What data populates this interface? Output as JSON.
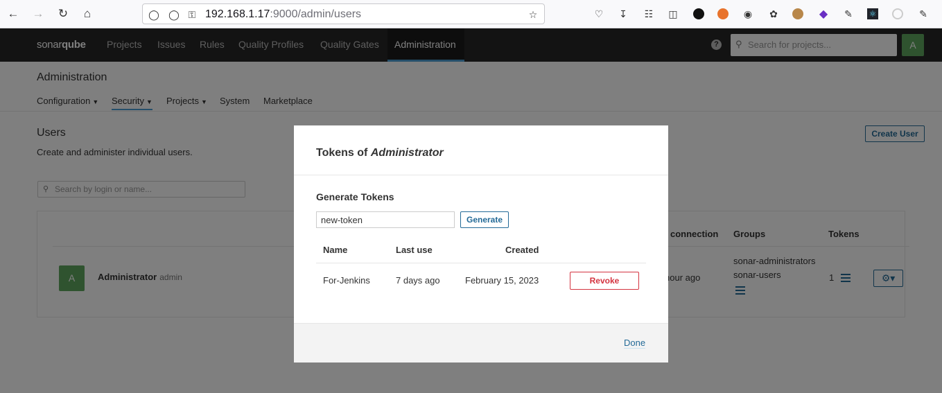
{
  "browser": {
    "url_host": "192.168.1.17",
    "url_path": ":9000/admin/users"
  },
  "nav": {
    "logo_a": "sonar",
    "logo_b": "qube",
    "items": [
      "Projects",
      "Issues",
      "Rules",
      "Quality Profiles",
      "Quality Gates",
      "Administration"
    ],
    "help": "?",
    "search_placeholder": "Search for projects...",
    "avatar_letter": "A"
  },
  "admin": {
    "title": "Administration",
    "menu": [
      {
        "label": "Configuration",
        "dropdown": true
      },
      {
        "label": "Security",
        "dropdown": true
      },
      {
        "label": "Projects",
        "dropdown": true
      },
      {
        "label": "System",
        "dropdown": false
      },
      {
        "label": "Marketplace",
        "dropdown": false
      }
    ]
  },
  "users": {
    "title": "Users",
    "description": "Create and administer individual users.",
    "create_label": "Create User",
    "search_placeholder": "Search by login or name...",
    "columns": {
      "last_connection": "connection",
      "groups": "Groups",
      "tokens": "Tokens"
    },
    "row": {
      "avatar_letter": "A",
      "name": "Administrator",
      "login": "admin",
      "last_connection": "hour ago",
      "groups": [
        "sonar-administrators",
        "sonar-users"
      ],
      "tokens_count": "1"
    }
  },
  "modal": {
    "title_prefix": "Tokens of ",
    "title_user": "Administrator",
    "generate_title": "Generate Tokens",
    "token_input_value": "new-token",
    "generate_label": "Generate",
    "headers": {
      "name": "Name",
      "last_use": "Last use",
      "created": "Created"
    },
    "tokens": [
      {
        "name": "For-Jenkins",
        "last_use": "7 days ago",
        "created": "February 15, 2023",
        "revoke_label": "Revoke"
      }
    ],
    "done_label": "Done"
  },
  "colors": {
    "nav_bg": "#262626",
    "accent": "#236a97",
    "danger": "#d4333f",
    "avatar": "#5ea75e"
  }
}
